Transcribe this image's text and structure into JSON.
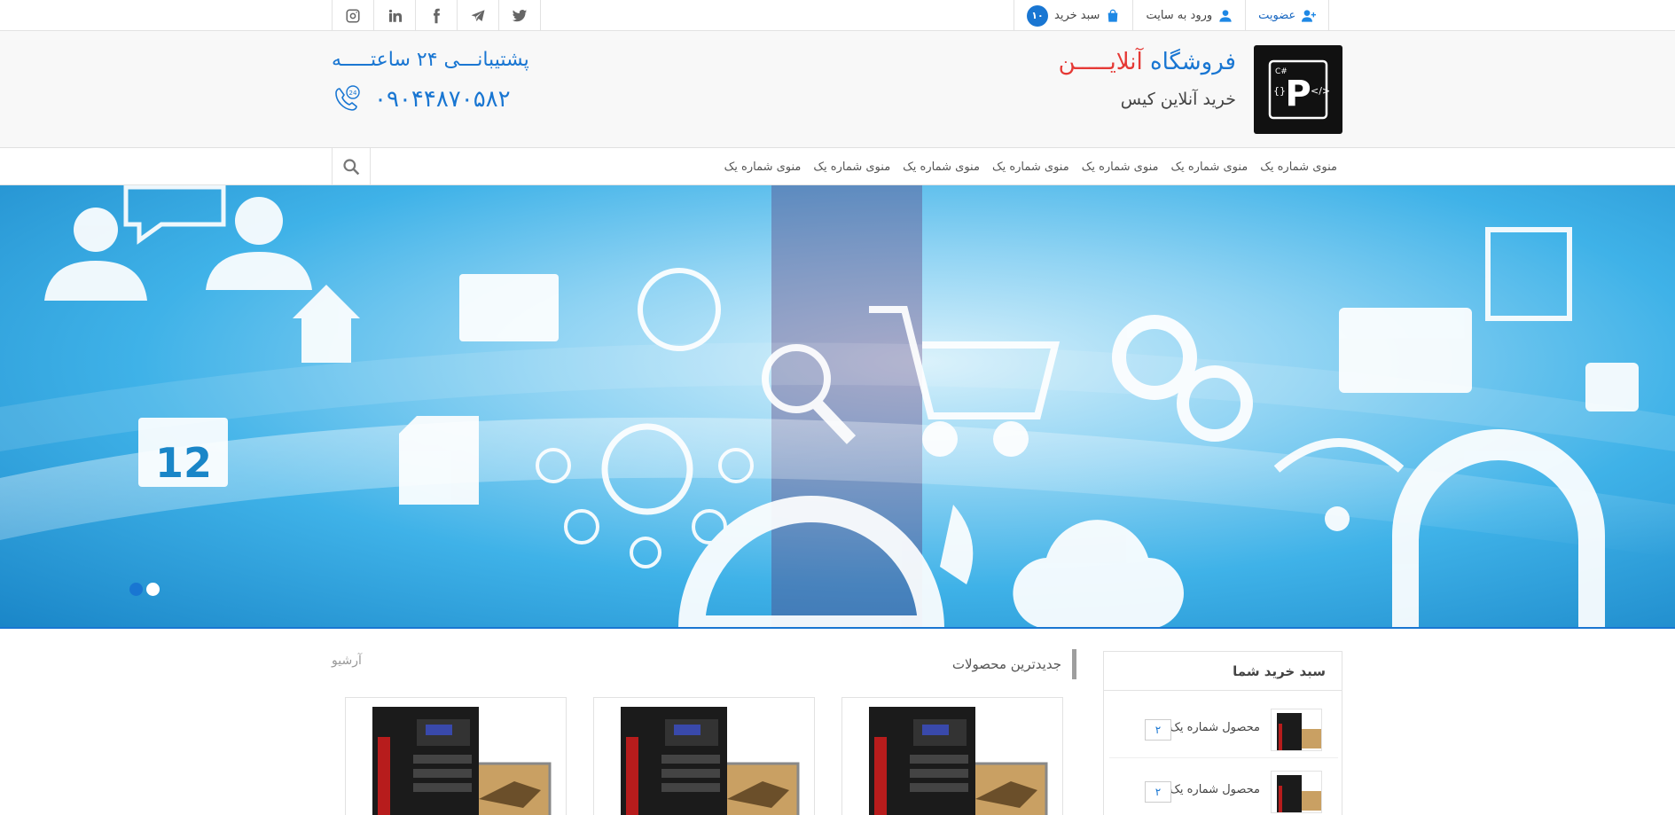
{
  "topbar": {
    "social_icons": [
      "instagram-icon",
      "linkedin-icon",
      "facebook-icon",
      "telegram-icon",
      "twitter-icon"
    ],
    "register_label": "عضویت",
    "login_label": "ورود به سایت",
    "cart_label": "سبد خرید",
    "cart_count": "۱۰"
  },
  "header": {
    "shop_title_part1": "فروشگاه",
    "shop_title_part2": "آنلایـــــن",
    "shop_subtitle": "خرید آنلاین کیس",
    "support_text": "پشتیبانـــی ۲۴ ساعتـــــه",
    "phone": "۰۹۰۴۴۸۷۰۵۸۲",
    "phone_badge": "24",
    "logo_letter": "P",
    "logo_tag": "C#",
    "logo_left": "{}",
    "logo_right": "</>"
  },
  "nav": {
    "items": [
      "منوی شماره یک",
      "منوی شماره یک",
      "منوی شماره یک",
      "منوی شماره یک",
      "منوی شماره یک",
      "منوی شماره یک",
      "منوی شماره یک"
    ]
  },
  "slider": {
    "calendar_number": "12",
    "dots": 2,
    "active_dot": 0
  },
  "content": {
    "newest_products_title": "جدیدترین محصولات",
    "archive_label": "آرشیو"
  },
  "cart": {
    "title": "سبد خرید شما",
    "items": [
      {
        "name": "محصول شماره یک",
        "qty": "۲"
      },
      {
        "name": "محصول شماره یک",
        "qty": "۲"
      }
    ]
  },
  "colors": {
    "accent": "#1976d2",
    "brand_red": "#e53935"
  }
}
